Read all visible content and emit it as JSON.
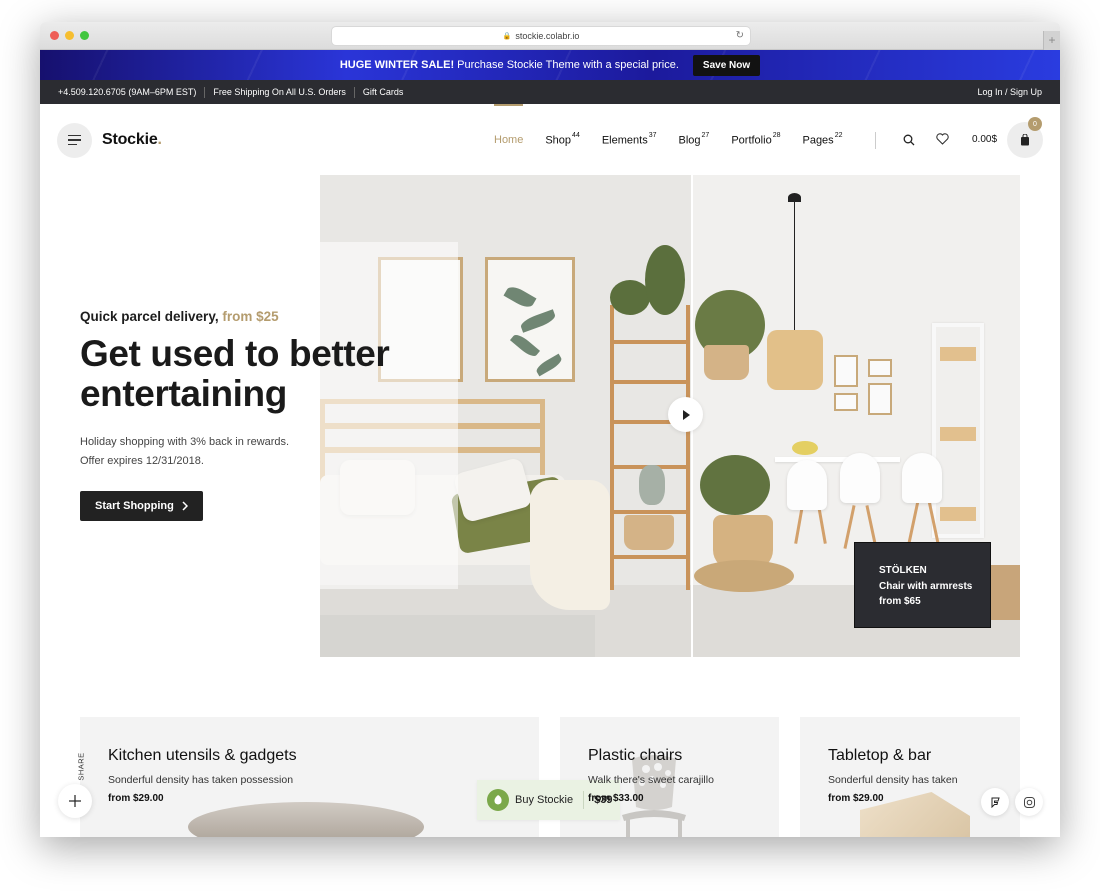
{
  "browser": {
    "url": "stockie.colabr.io",
    "traffic_lights": [
      "#ee5e57",
      "#f6be2f",
      "#42c63f"
    ],
    "new_tab_label": "+"
  },
  "promo": {
    "headline": "HUGE WINTER SALE!",
    "text": "Purchase Stockie Theme with a special price.",
    "button": "Save Now"
  },
  "topbar": {
    "phone": "+4.509.120.6705 (9AM–6PM EST)",
    "shipping": "Free Shipping On All U.S. Orders",
    "gift": "Gift Cards",
    "login": "Log In / Sign Up"
  },
  "header": {
    "logo": "Stockie",
    "logo_dot": ".",
    "nav": [
      {
        "label": "Home",
        "count": ""
      },
      {
        "label": "Shop",
        "count": "44"
      },
      {
        "label": "Elements",
        "count": "37"
      },
      {
        "label": "Blog",
        "count": "27"
      },
      {
        "label": "Portfolio",
        "count": "28"
      },
      {
        "label": "Pages",
        "count": "22"
      }
    ],
    "cart_total": "0.00$",
    "cart_count": "0",
    "accent": "#b49c6e"
  },
  "hero": {
    "eyebrow": "Quick parcel delivery,",
    "eyebrow_accent": "from $25",
    "headline_line1": "Get used to better",
    "headline_line2": "entertaining",
    "sub_line1": "Holiday shopping with 3% back in rewards.",
    "sub_line2": "Offer expires 12/31/2018.",
    "cta": "Start Shopping",
    "product": {
      "name": "STÖLKEN",
      "desc": "Chair with armrests",
      "price": "from $65"
    }
  },
  "cards": [
    {
      "title": "Kitchen utensils & gadgets",
      "desc": "Sonderful density has taken possession",
      "price": "from $29.00"
    },
    {
      "title": "Plastic chairs",
      "desc": "Walk there's sweet carajillo",
      "price": "from $33.00"
    },
    {
      "title": "Tabletop & bar",
      "desc": "Sonderful density has taken",
      "price": "from $29.00"
    }
  ],
  "floating": {
    "share_label": "SHARE",
    "buy_label": "Buy Stockie",
    "buy_price": "$39"
  }
}
